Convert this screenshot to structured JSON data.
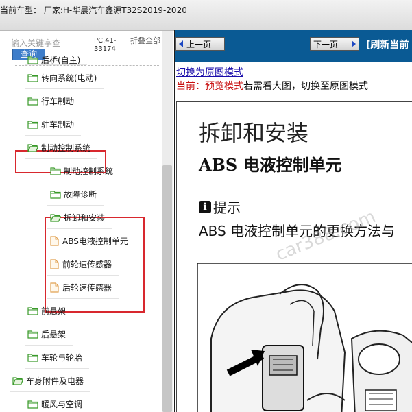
{
  "header": {
    "vehicle": "当前车型： 厂家:H-华晨汽车鑫源T32S2019-2020"
  },
  "sidebar": {
    "search": {
      "placeholder": "输入关键字查",
      "button": "查询"
    },
    "pc_code": "PC.41-33174",
    "collapse_all": "折叠全部",
    "partial_top": "后桥(自主)",
    "tree": [
      {
        "label": "转向系统(电动)",
        "type": "folder"
      },
      {
        "label": "行车制动",
        "type": "folder"
      },
      {
        "label": "驻车制动",
        "type": "folder"
      },
      {
        "label": "制动控制系统",
        "type": "folder-open"
      },
      {
        "label": "制动控制系统",
        "type": "folder"
      },
      {
        "label": "故障诊断",
        "type": "folder"
      },
      {
        "label": "拆卸和安装",
        "type": "folder-open"
      },
      {
        "label": "ABS电液控制单元",
        "type": "doc"
      },
      {
        "label": "前轮速传感器",
        "type": "doc"
      },
      {
        "label": "后轮速传感器",
        "type": "doc"
      },
      {
        "label": "前悬架",
        "type": "folder"
      },
      {
        "label": "后悬架",
        "type": "folder"
      },
      {
        "label": "车轮与轮胎",
        "type": "folder"
      },
      {
        "label": "车身附件及电器",
        "type": "folder-open"
      },
      {
        "label": "暖风与空调",
        "type": "folder"
      }
    ]
  },
  "viewer": {
    "prev_button": "上一页",
    "next_button": "下一页",
    "refresh_link": "[刷新当前",
    "switch_link": "切换为原图模式",
    "preview_prefix": "当前：预览模式",
    "preview_suffix": "若需看大图，切换至原图模式",
    "doc": {
      "title": "拆卸和安装",
      "subtitle": "ABS 电液控制单元",
      "hint": "提示",
      "desc": "ABS 电液控制单元的更换方法与",
      "watermark": "car388.com"
    }
  },
  "colors": {
    "nav_blue": "#0a5a94",
    "highlight_red": "#d8282e",
    "folder_green": "#3a9a2a",
    "link_blue": "#1a0dab"
  }
}
